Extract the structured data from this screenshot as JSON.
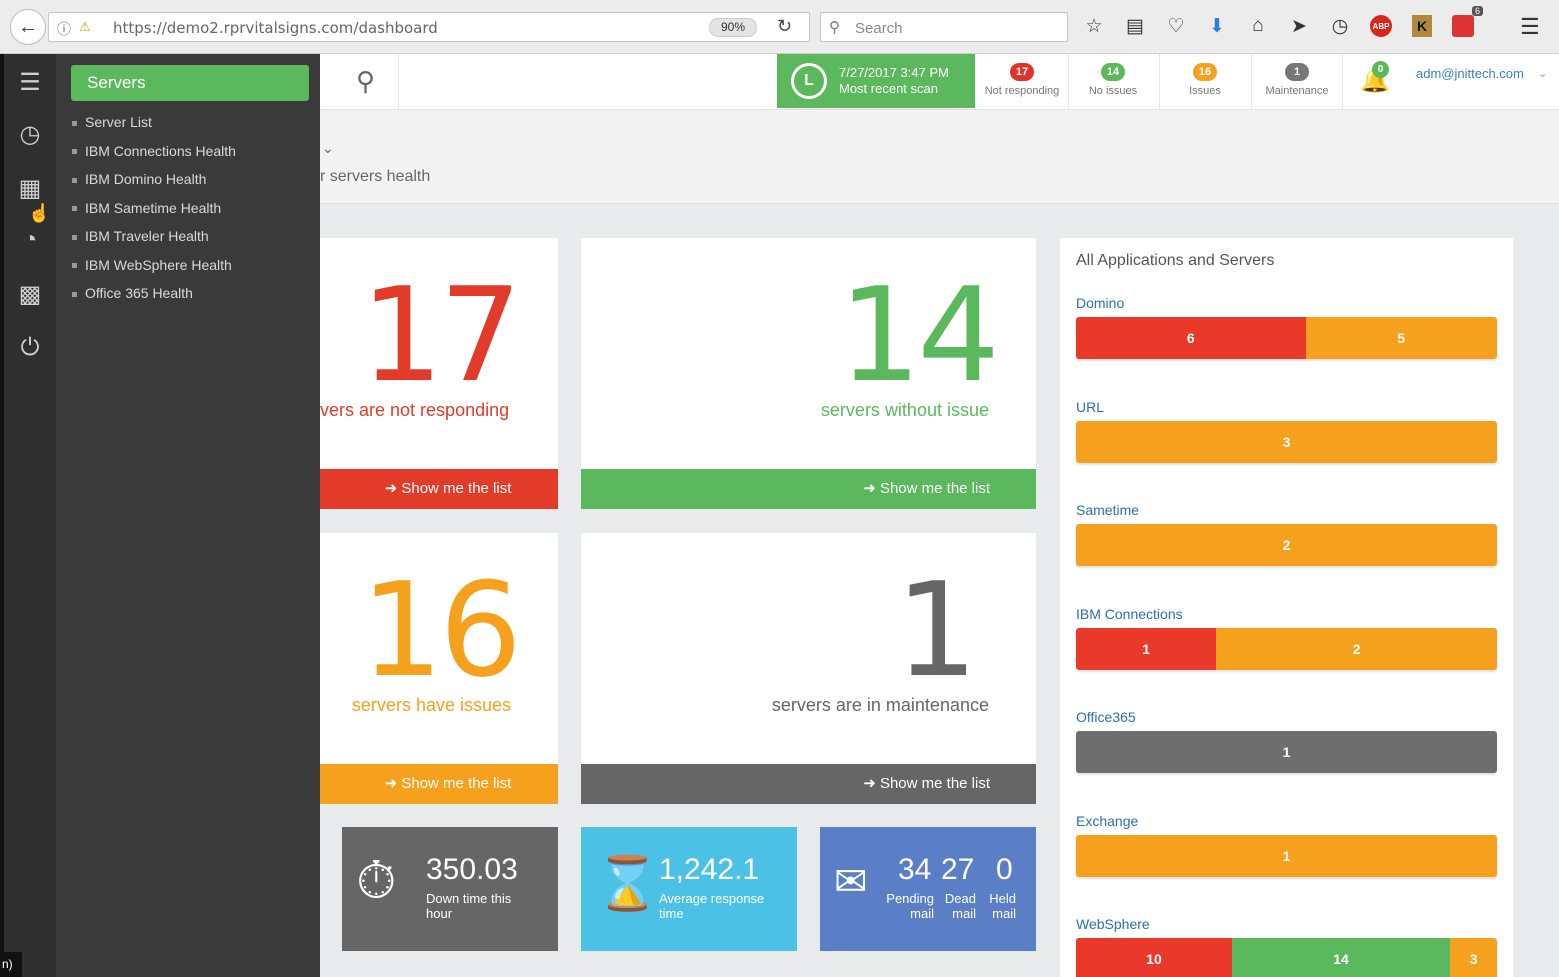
{
  "browser": {
    "url": "https://demo2.rprvitalsigns.com/dashboard",
    "zoom": "90%",
    "search_placeholder": "Search",
    "abp_label": "ABP",
    "k_label": "K",
    "notif_count": "6"
  },
  "header": {
    "scan_date": "7/27/2017 3:47 PM",
    "scan_label": "Most recent scan",
    "stats": [
      {
        "count": "17",
        "label": "Not responding",
        "color": "#e0342a"
      },
      {
        "count": "14",
        "label": "No issues",
        "color": "#5cb85c"
      },
      {
        "count": "16",
        "label": "Issues",
        "color": "#f6a11e"
      },
      {
        "count": "1",
        "label": "Maintenance",
        "color": "#777777"
      }
    ],
    "bell_count": "0",
    "user": "adm@jnittech.com"
  },
  "page": {
    "subtitle": "r servers health"
  },
  "flyout": {
    "title": "Servers",
    "items": [
      "Server List",
      "IBM Connections Health",
      "IBM Domino Health",
      "IBM Sametime Health",
      "IBM Traveler Health",
      "IBM WebSphere Health",
      "Office 365 Health"
    ]
  },
  "cards": {
    "not_responding": {
      "number": "17",
      "text_prefix": "vers are ",
      "text_strong": "not responding",
      "button": "Show me the list",
      "color": "#e23b2a"
    },
    "no_issue": {
      "number": "14",
      "text_prefix": "servers ",
      "text_strong": "without issue",
      "button": "Show me the list",
      "color": "#5cb85c"
    },
    "issues": {
      "number": "16",
      "text_prefix": "servers ",
      "text_strong": "have issues",
      "button": "Show me the list",
      "color": "#f6a11e"
    },
    "maintenance": {
      "number": "1",
      "text_prefix": "servers ",
      "text_strong": "are in maintenance",
      "button": "Show me the list",
      "color": "#666666"
    }
  },
  "tiles": {
    "downtime": {
      "value": "350.03",
      "label": "Down time this hour"
    },
    "response": {
      "value": "1,242.1",
      "label": "Average response time"
    },
    "mail": {
      "pending_value": "34",
      "pending_label_1": "Pending",
      "pending_label_2": "mail",
      "dead_value": "27",
      "dead_label_1": "Dead",
      "dead_label_2": "mail",
      "held_value": "0",
      "held_label_1": "Held",
      "held_label_2": "mail"
    }
  },
  "panel": {
    "title": "All Applications and Servers",
    "apps": [
      {
        "name": "Domino",
        "segments": [
          {
            "value": "6",
            "color": "#e8392b"
          },
          {
            "value": "5",
            "color": "#f6a11e"
          }
        ]
      },
      {
        "name": "URL",
        "segments": [
          {
            "value": "3",
            "color": "#f6a11e"
          }
        ]
      },
      {
        "name": "Sametime",
        "segments": [
          {
            "value": "2",
            "color": "#f6a11e"
          }
        ]
      },
      {
        "name": "IBM Connections",
        "segments": [
          {
            "value": "1",
            "color": "#e8392b"
          },
          {
            "value": "2",
            "color": "#f6a11e"
          }
        ]
      },
      {
        "name": "Office365",
        "segments": [
          {
            "value": "1",
            "color": "#6e6e6e"
          }
        ]
      },
      {
        "name": "Exchange",
        "segments": [
          {
            "value": "1",
            "color": "#f6a11e"
          }
        ]
      },
      {
        "name": "WebSphere",
        "segments": [
          {
            "value": "10",
            "color": "#e8392b"
          },
          {
            "value": "14",
            "color": "#5cb85c"
          },
          {
            "value": "3",
            "color": "#f6a11e"
          }
        ]
      }
    ]
  },
  "corner_char": "n)"
}
